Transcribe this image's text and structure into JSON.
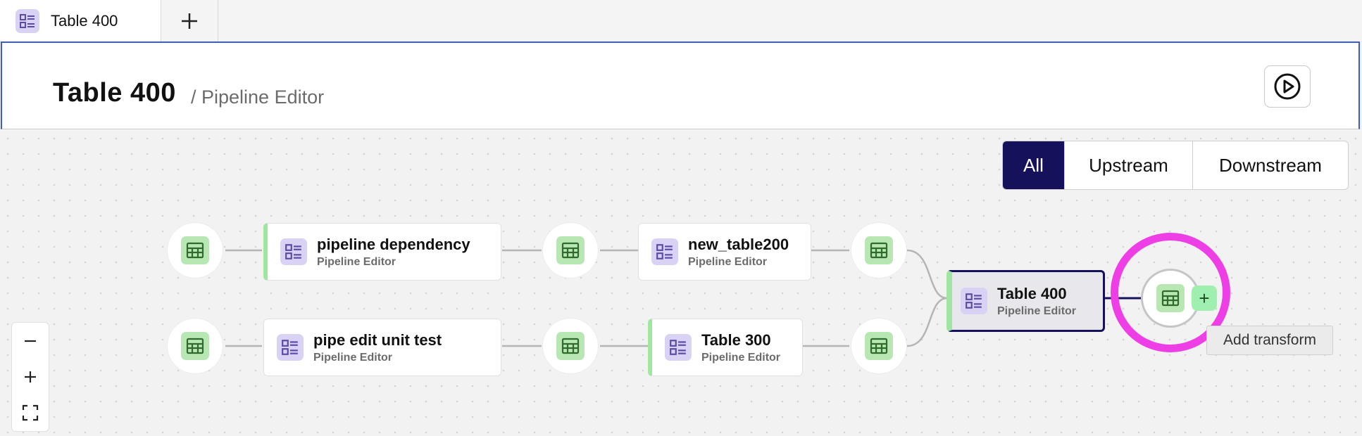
{
  "tabs": [
    {
      "label": "Table 400",
      "icon": "pipeline-icon"
    }
  ],
  "header": {
    "title": "Table 400",
    "subtitle": "/ Pipeline Editor"
  },
  "filters": {
    "all": "All",
    "upstream": "Upstream",
    "downstream": "Downstream",
    "active": "All"
  },
  "nodes": {
    "pipeline_dependency": {
      "name": "pipeline dependency",
      "type": "Pipeline Editor"
    },
    "new_table200": {
      "name": "new_table200",
      "type": "Pipeline Editor"
    },
    "pipe_edit_unit_test": {
      "name": "pipe edit unit test",
      "type": "Pipeline Editor"
    },
    "table_300": {
      "name": "Table 300",
      "type": "Pipeline Editor"
    },
    "table_400": {
      "name": "Table 400",
      "type": "Pipeline Editor"
    }
  },
  "tooltip": "Add transform",
  "add_symbol": "+",
  "colors": {
    "accent": "#15115a",
    "highlight": "#ee3ee6",
    "dataset": "#b9e7b4",
    "pipeline": "#d9d2f5"
  }
}
